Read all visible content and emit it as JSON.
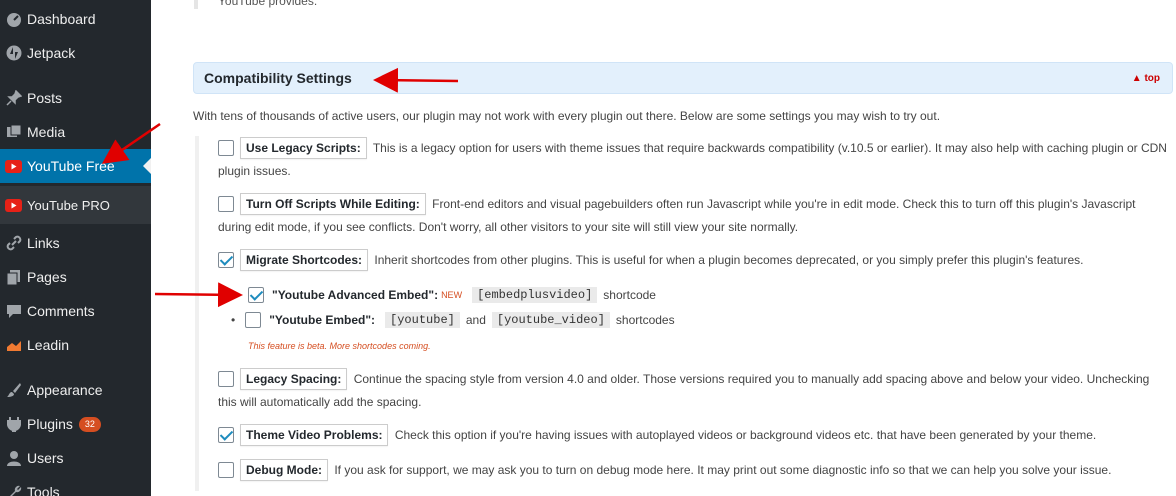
{
  "sidebar": {
    "items": [
      {
        "label": "Dashboard",
        "icon": "dashboard-icon"
      },
      {
        "label": "Jetpack",
        "icon": "jetpack-icon"
      },
      {
        "label": "Posts",
        "icon": "pin-icon"
      },
      {
        "label": "Media",
        "icon": "media-icon"
      },
      {
        "label": "YouTube Free",
        "icon": "youtube-icon"
      },
      {
        "label": "YouTube PRO",
        "icon": "youtube-icon"
      },
      {
        "label": "Links",
        "icon": "link-icon"
      },
      {
        "label": "Pages",
        "icon": "pages-icon"
      },
      {
        "label": "Comments",
        "icon": "comment-icon"
      },
      {
        "label": "Leadin",
        "icon": "leadin-icon"
      },
      {
        "label": "Appearance",
        "icon": "brush-icon"
      },
      {
        "label": "Plugins",
        "icon": "plugin-icon",
        "badge": "32"
      },
      {
        "label": "Users",
        "icon": "user-icon"
      },
      {
        "label": "Tools",
        "icon": "wrench-icon"
      }
    ]
  },
  "main": {
    "top_note": "YouTube provides.",
    "section_title": "Compatibility Settings",
    "top_link": "▲ top",
    "intro": "With tens of thousands of active users, our plugin may not work with every plugin out there. Below are some settings you may wish to try out.",
    "options": [
      {
        "label": "Use Legacy Scripts:",
        "checked": false,
        "text": "This is a legacy option for users with theme issues that require backwards compatibility (v.10.5 or earlier). It may also help with caching plugin or CDN plugin issues."
      },
      {
        "label": "Turn Off Scripts While Editing:",
        "checked": false,
        "text": "Front-end editors and visual pagebuilders often run Javascript while you're in edit mode. Check this to turn off this plugin's Javascript during edit mode, if you see conflicts. Don't worry, all other visitors to your site will still view your site normally."
      },
      {
        "label": "Migrate Shortcodes:",
        "checked": true,
        "text": "Inherit shortcodes from other plugins. This is useful for when a plugin becomes deprecated, or you simply prefer this plugin's features."
      },
      {
        "label": "Legacy Spacing:",
        "checked": false,
        "text": "Continue the spacing style from version 4.0 and older. Those versions required you to manually add spacing above and below your video. Unchecking this will automatically add the spacing."
      },
      {
        "label": "Theme Video Problems:",
        "checked": true,
        "text": "Check this option if you're having issues with autoplayed videos or background videos etc. that have been generated by your theme."
      },
      {
        "label": "Debug Mode:",
        "checked": false,
        "text": "If you ask for support, we may ask you to turn on debug mode here. It may print out some diagnostic info so that we can help you solve your issue."
      }
    ],
    "shortcodes": {
      "advanced": {
        "label": "\"Youtube Advanced Embed\":",
        "new": "NEW",
        "code": "[embedplusvideo]",
        "suffix": "shortcode",
        "checked": true
      },
      "embed": {
        "bullet": "•",
        "label": "\"Youtube Embed\":",
        "code1": "[youtube]",
        "and": "and",
        "code2": "[youtube_video]",
        "suffix": "shortcodes",
        "checked": false
      },
      "beta_note": "This feature is beta. More shortcodes coming."
    }
  },
  "colors": {
    "sidebar_bg": "#23282d",
    "active": "#0073aa",
    "annotation_arrow": "#e00000",
    "header_bg": "#e3f0fc"
  }
}
